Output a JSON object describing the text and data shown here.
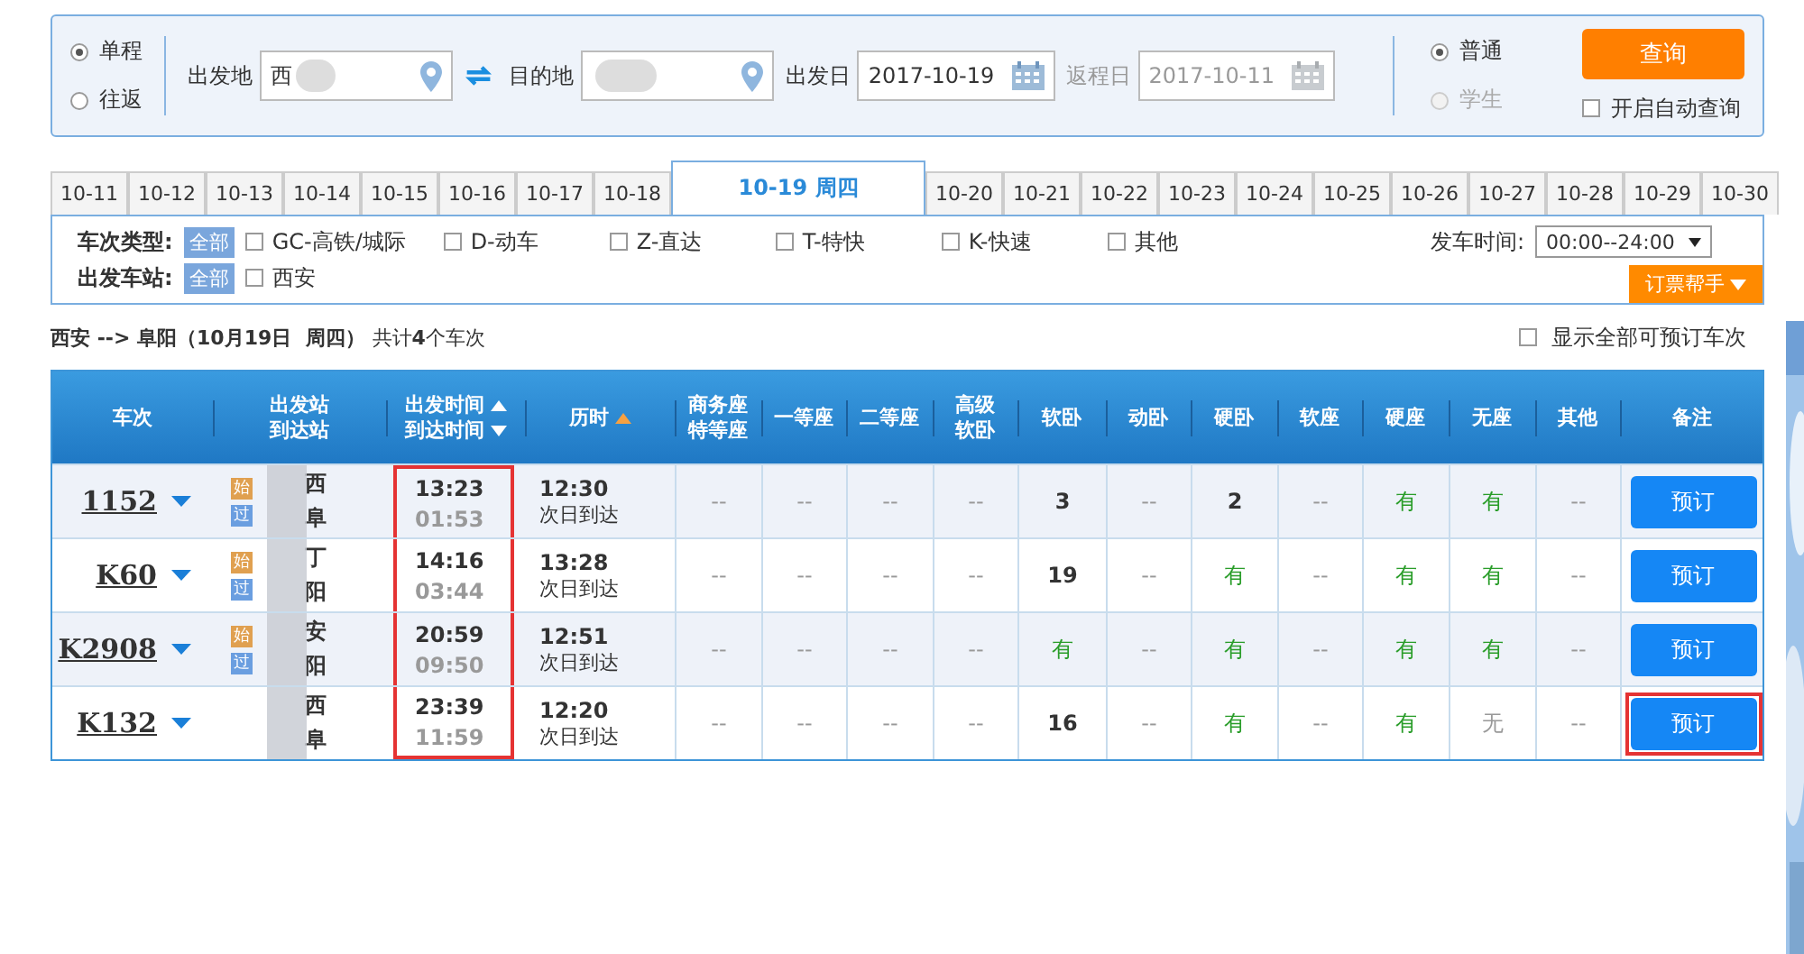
{
  "search": {
    "trip_types": [
      {
        "label": "单程",
        "selected": true
      },
      {
        "label": "往返",
        "selected": false
      }
    ],
    "from": {
      "label": "出发地",
      "value": "西"
    },
    "to": {
      "label": "目的地"
    },
    "depart_date": {
      "label": "出发日",
      "value": "2017-10-19"
    },
    "return_date": {
      "label": "返程日",
      "value": "2017-10-11",
      "disabled": true
    },
    "passenger_types": [
      {
        "label": "普通",
        "selected": true,
        "disabled": false
      },
      {
        "label": "学生",
        "selected": false,
        "disabled": true
      }
    ],
    "query_button": "查询",
    "auto_query": {
      "label": "开启自动查询",
      "checked": false
    }
  },
  "date_tabs": [
    {
      "label": "10-11",
      "selected": false
    },
    {
      "label": "10-12",
      "selected": false
    },
    {
      "label": "10-13",
      "selected": false
    },
    {
      "label": "10-14",
      "selected": false
    },
    {
      "label": "10-15",
      "selected": false
    },
    {
      "label": "10-16",
      "selected": false
    },
    {
      "label": "10-17",
      "selected": false
    },
    {
      "label": "10-18",
      "selected": false
    },
    {
      "label": "10-19 周四",
      "selected": true
    },
    {
      "label": "10-20",
      "selected": false
    },
    {
      "label": "10-21",
      "selected": false
    },
    {
      "label": "10-22",
      "selected": false
    },
    {
      "label": "10-23",
      "selected": false
    },
    {
      "label": "10-24",
      "selected": false
    },
    {
      "label": "10-25",
      "selected": false
    },
    {
      "label": "10-26",
      "selected": false
    },
    {
      "label": "10-27",
      "selected": false
    },
    {
      "label": "10-28",
      "selected": false
    },
    {
      "label": "10-29",
      "selected": false
    },
    {
      "label": "10-30",
      "selected": false
    }
  ],
  "filters": {
    "train_type": {
      "label": "车次类型:",
      "all": "全部",
      "options": [
        {
          "label": "GC-高铁/城际",
          "checked": false
        },
        {
          "label": "D-动车",
          "checked": false
        },
        {
          "label": "Z-直达",
          "checked": false
        },
        {
          "label": "T-特快",
          "checked": false
        },
        {
          "label": "K-快速",
          "checked": false
        },
        {
          "label": "其他",
          "checked": false
        }
      ]
    },
    "station": {
      "label": "出发车站:",
      "all": "全部",
      "options": [
        {
          "label": "西安",
          "checked": false
        }
      ]
    },
    "depart_time": {
      "label": "发车时间:",
      "value": "00:00--24:00"
    },
    "helper_button": "订票帮手"
  },
  "route": {
    "title": "西安 --> 阜阳（10月19日  周四）",
    "count": "共计**4**个车次"
  },
  "show_all": {
    "label": "显示全部可预订车次",
    "checked": false
  },
  "table": {
    "columns": [
      {
        "lines": [
          "车次"
        ],
        "sort_arrows": false,
        "sorted": false
      },
      {
        "lines": [
          "出发站",
          "到达站"
        ],
        "sort_arrows": false,
        "sorted": false
      },
      {
        "lines": [
          "出发时间",
          "到达时间"
        ],
        "sort_arrows": true,
        "sorted": false
      },
      {
        "lines": [
          "历时"
        ],
        "sort_arrows": false,
        "sorted": true
      },
      {
        "lines": [
          "商务座",
          "特等座"
        ],
        "sort_arrows": false,
        "sorted": false
      },
      {
        "lines": [
          "一等座"
        ],
        "sort_arrows": false,
        "sorted": false
      },
      {
        "lines": [
          "二等座"
        ],
        "sort_arrows": false,
        "sorted": false
      },
      {
        "lines": [
          "高级",
          "软卧"
        ],
        "sort_arrows": false,
        "sorted": false
      },
      {
        "lines": [
          "软卧"
        ],
        "sort_arrows": false,
        "sorted": false
      },
      {
        "lines": [
          "动卧"
        ],
        "sort_arrows": false,
        "sorted": false
      },
      {
        "lines": [
          "硬卧"
        ],
        "sort_arrows": false,
        "sorted": false
      },
      {
        "lines": [
          "软座"
        ],
        "sort_arrows": false,
        "sorted": false
      },
      {
        "lines": [
          "硬座"
        ],
        "sort_arrows": false,
        "sorted": false
      },
      {
        "lines": [
          "无座"
        ],
        "sort_arrows": false,
        "sorted": false
      },
      {
        "lines": [
          "其他"
        ],
        "sort_arrows": false,
        "sorted": false
      },
      {
        "lines": [
          "备注"
        ],
        "sort_arrows": false,
        "sorted": false
      }
    ],
    "time_column_highlighted": true,
    "rows": [
      {
        "train": "1152",
        "badges": [
          {
            "text": "始",
            "kind": "start"
          },
          {
            "text": "过",
            "kind": "pass"
          }
        ],
        "stations": [
          "西",
          "阜"
        ],
        "depart": "13:23",
        "arrive": "01:53",
        "duration": "12:30",
        "arrive_day": "次日到达",
        "seats": [
          {
            "text": "--",
            "kind": "none"
          },
          {
            "text": "--",
            "kind": "none"
          },
          {
            "text": "--",
            "kind": "none"
          },
          {
            "text": "--",
            "kind": "none"
          },
          {
            "text": "3",
            "kind": "count"
          },
          {
            "text": "--",
            "kind": "none"
          },
          {
            "text": "2",
            "kind": "count"
          },
          {
            "text": "--",
            "kind": "none"
          },
          {
            "text": "有",
            "kind": "available"
          },
          {
            "text": "有",
            "kind": "available"
          },
          {
            "text": "--",
            "kind": "none"
          }
        ],
        "book": "预订",
        "book_highlighted": false
      },
      {
        "train": "K60",
        "badges": [
          {
            "text": "始",
            "kind": "start"
          },
          {
            "text": "过",
            "kind": "pass"
          }
        ],
        "stations": [
          "丁",
          "阳"
        ],
        "depart": "14:16",
        "arrive": "03:44",
        "duration": "13:28",
        "arrive_day": "次日到达",
        "seats": [
          {
            "text": "--",
            "kind": "none"
          },
          {
            "text": "--",
            "kind": "none"
          },
          {
            "text": "--",
            "kind": "none"
          },
          {
            "text": "--",
            "kind": "none"
          },
          {
            "text": "19",
            "kind": "count"
          },
          {
            "text": "--",
            "kind": "none"
          },
          {
            "text": "有",
            "kind": "available"
          },
          {
            "text": "--",
            "kind": "none"
          },
          {
            "text": "有",
            "kind": "available"
          },
          {
            "text": "有",
            "kind": "available"
          },
          {
            "text": "--",
            "kind": "none"
          }
        ],
        "book": "预订",
        "book_highlighted": false
      },
      {
        "train": "K2908",
        "badges": [
          {
            "text": "始",
            "kind": "start"
          },
          {
            "text": "过",
            "kind": "pass"
          }
        ],
        "stations": [
          "安",
          "阳"
        ],
        "depart": "20:59",
        "arrive": "09:50",
        "duration": "12:51",
        "arrive_day": "次日到达",
        "seats": [
          {
            "text": "--",
            "kind": "none"
          },
          {
            "text": "--",
            "kind": "none"
          },
          {
            "text": "--",
            "kind": "none"
          },
          {
            "text": "--",
            "kind": "none"
          },
          {
            "text": "有",
            "kind": "available"
          },
          {
            "text": "--",
            "kind": "none"
          },
          {
            "text": "有",
            "kind": "available"
          },
          {
            "text": "--",
            "kind": "none"
          },
          {
            "text": "有",
            "kind": "available"
          },
          {
            "text": "有",
            "kind": "available"
          },
          {
            "text": "--",
            "kind": "none"
          }
        ],
        "book": "预订",
        "book_highlighted": false
      },
      {
        "train": "K132",
        "badges": [],
        "stations": [
          "西",
          "阜"
        ],
        "depart": "23:39",
        "arrive": "11:59",
        "duration": "12:20",
        "arrive_day": "次日到达",
        "seats": [
          {
            "text": "--",
            "kind": "none"
          },
          {
            "text": "--",
            "kind": "none"
          },
          {
            "text": "--",
            "kind": "none"
          },
          {
            "text": "--",
            "kind": "none"
          },
          {
            "text": "16",
            "kind": "count"
          },
          {
            "text": "--",
            "kind": "none"
          },
          {
            "text": "有",
            "kind": "available"
          },
          {
            "text": "--",
            "kind": "none"
          },
          {
            "text": "有",
            "kind": "available"
          },
          {
            "text": "无",
            "kind": "soldout"
          },
          {
            "text": "--",
            "kind": "none"
          }
        ],
        "book": "预订",
        "book_highlighted": true
      }
    ]
  }
}
